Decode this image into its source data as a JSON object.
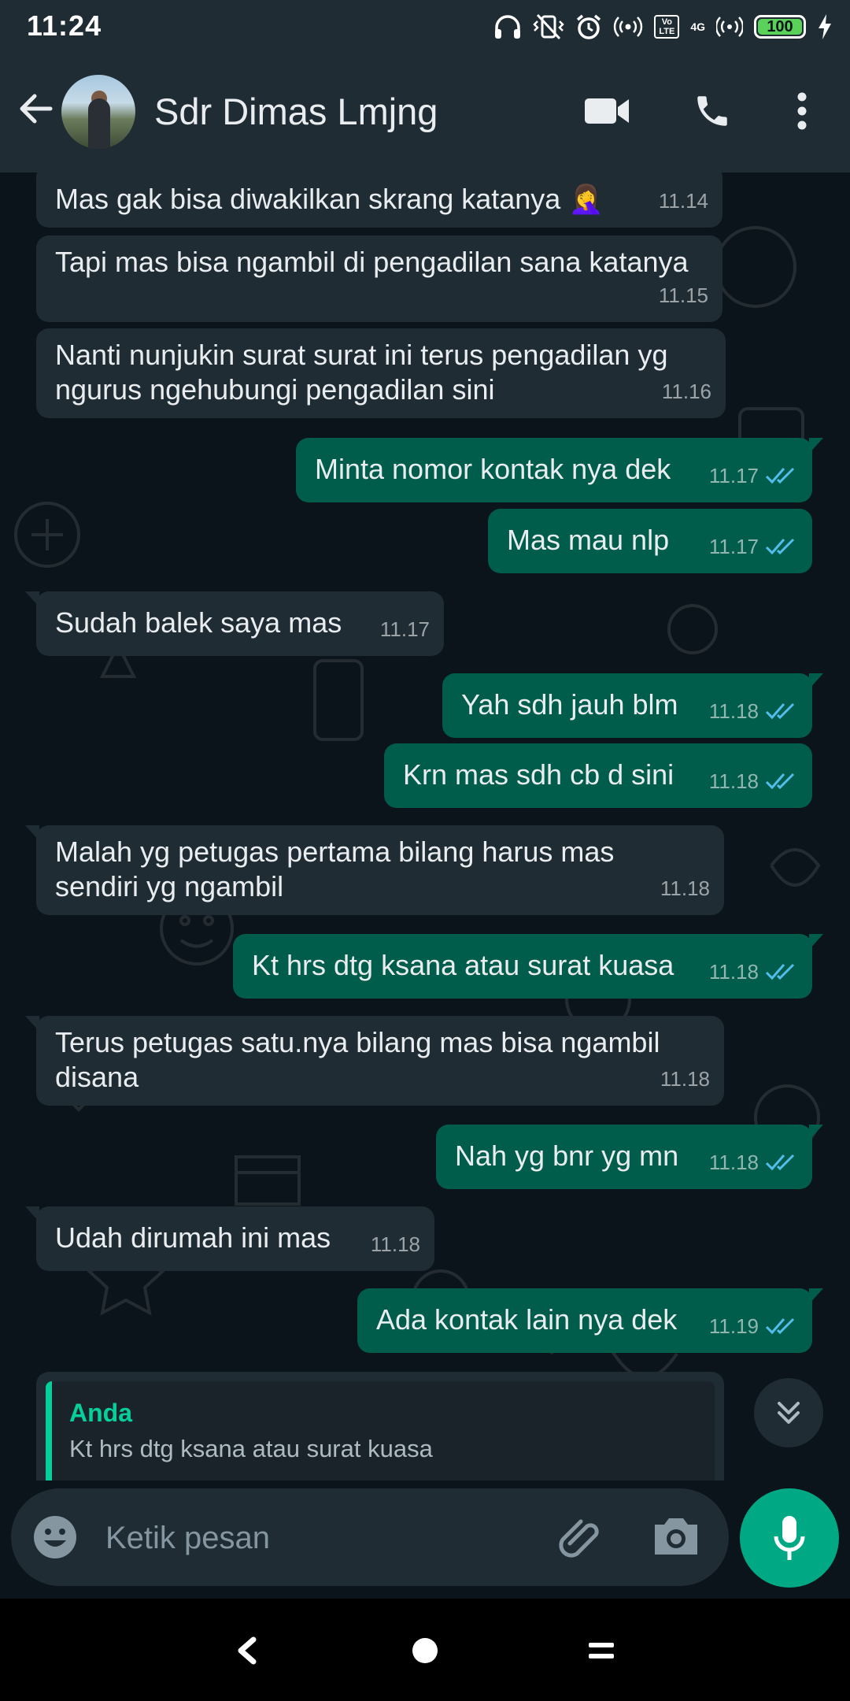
{
  "status_bar": {
    "time": "11:24",
    "battery": "100",
    "network": "4G"
  },
  "header": {
    "contact_name": "Sdr Dimas Lmjng"
  },
  "messages": [
    {
      "dir": "in",
      "text": "Mas gak bisa diwakilkan skrang katanya 🤦‍♀️",
      "time": "11.14"
    },
    {
      "dir": "in",
      "text": "Tapi mas bisa ngambil di pengadilan sana katanya",
      "time": "11.15"
    },
    {
      "dir": "in",
      "text_lines": [
        "Nanti nunjukin surat surat ini terus pengadilan yg",
        "ngurus ngehubungi pengadilan sini"
      ],
      "time": "11.16"
    },
    {
      "dir": "out",
      "text": "Minta nomor kontak nya dek",
      "time": "11.17"
    },
    {
      "dir": "out",
      "text": "Mas  mau nlp",
      "time": "11.17"
    },
    {
      "dir": "in",
      "text": "Sudah balek saya mas",
      "time": "11.17"
    },
    {
      "dir": "out",
      "text": "Yah sdh jauh blm",
      "time": "11.18"
    },
    {
      "dir": "out",
      "text": "Krn mas sdh cb d sini",
      "time": "11.18"
    },
    {
      "dir": "in",
      "text_lines": [
        "Malah yg petugas pertama bilang harus mas",
        "sendiri yg ngambil"
      ],
      "time": "11.18"
    },
    {
      "dir": "out",
      "text": "Kt hrs dtg ksana atau surat kuasa",
      "time": "11.18"
    },
    {
      "dir": "in",
      "text_lines": [
        "Terus petugas satu.nya bilang mas bisa ngambil",
        "disana"
      ],
      "time": "11.18"
    },
    {
      "dir": "out",
      "text": "Nah yg bnr yg mn",
      "time": "11.18"
    },
    {
      "dir": "in",
      "text": "Udah dirumah ini mas",
      "time": "11.18"
    },
    {
      "dir": "out",
      "text": "Ada kontak lain nya dek",
      "time": "11.19"
    }
  ],
  "reply_preview": {
    "author": "Anda",
    "text": "Kt hrs dtg ksana atau surat kuasa"
  },
  "composer": {
    "placeholder": "Ketik pesan"
  },
  "colors": {
    "header_bg": "#1f2c34",
    "chat_bg": "#0b141a",
    "outgoing_bubble": "#005c4b",
    "incoming_bubble": "#1f2c34",
    "accent": "#00a884",
    "read_ticks": "#53bdeb"
  },
  "icons": [
    "back-arrow-icon",
    "video-call-icon",
    "phone-icon",
    "more-options-icon",
    "double-check-icon",
    "chevrons-down-icon",
    "emoji-icon",
    "attach-icon",
    "camera-icon",
    "mic-icon",
    "headphones-icon",
    "vibrate-off-icon",
    "alarm-icon",
    "hotspot-icon",
    "signal-icon",
    "charging-icon"
  ]
}
